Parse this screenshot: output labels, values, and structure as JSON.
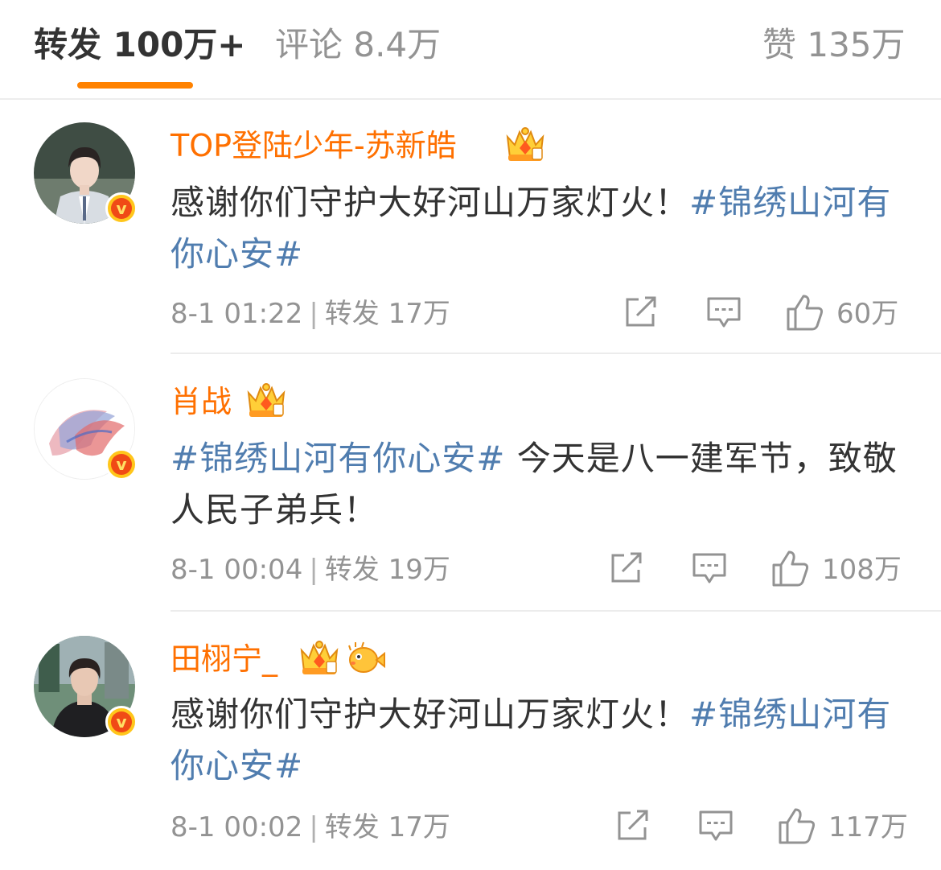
{
  "tabs": {
    "repost": "转发 100万+",
    "comments": "评论 8.4万",
    "likes": "赞 135万"
  },
  "colors": {
    "accent": "#ff8200",
    "username": "#ff7000",
    "hashtag": "#507daf",
    "text": "#333333",
    "muted": "#939393"
  },
  "posts": [
    {
      "username": "TOP登陆少年-苏新皓",
      "badges": [
        "crown-badge-icon"
      ],
      "text": "感谢你们守护大好河山万家灯火！",
      "hashtag": "#锦绣山河有你心安#",
      "time": "8-1 01:22",
      "repost": "转发 17万",
      "likes": "60万",
      "verified": "v"
    },
    {
      "username": "肖战",
      "badges": [
        "crown-badge-icon"
      ],
      "hashtag": "#锦绣山河有你心安#",
      "text": " 今天是八一建军节，致敬人民子弟兵！",
      "time": "8-1 00:04",
      "repost": "转发 19万",
      "likes": "108万",
      "verified": "v"
    },
    {
      "username": "田栩宁_",
      "badges": [
        "crown-badge-icon",
        "pufferfish-badge-icon"
      ],
      "text": "感谢你们守护大好河山万家灯火！",
      "hashtag": "#锦绣山河有你心安#",
      "time": "8-1 00:02",
      "repost": "转发 17万",
      "likes": "117万",
      "verified": "v"
    }
  ]
}
